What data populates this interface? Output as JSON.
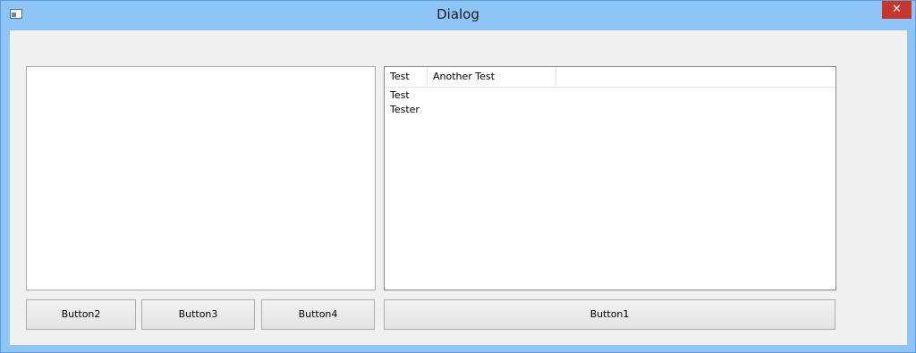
{
  "window": {
    "title": "Dialog",
    "close_symbol": "✕",
    "icon": "app-window-icon"
  },
  "tree": {
    "columns": [
      "Test",
      "Another Test"
    ],
    "rows": [
      "Test",
      "Tester"
    ]
  },
  "buttons": {
    "button2": "Button2",
    "button3": "Button3",
    "button4": "Button4",
    "button1": "Button1"
  }
}
